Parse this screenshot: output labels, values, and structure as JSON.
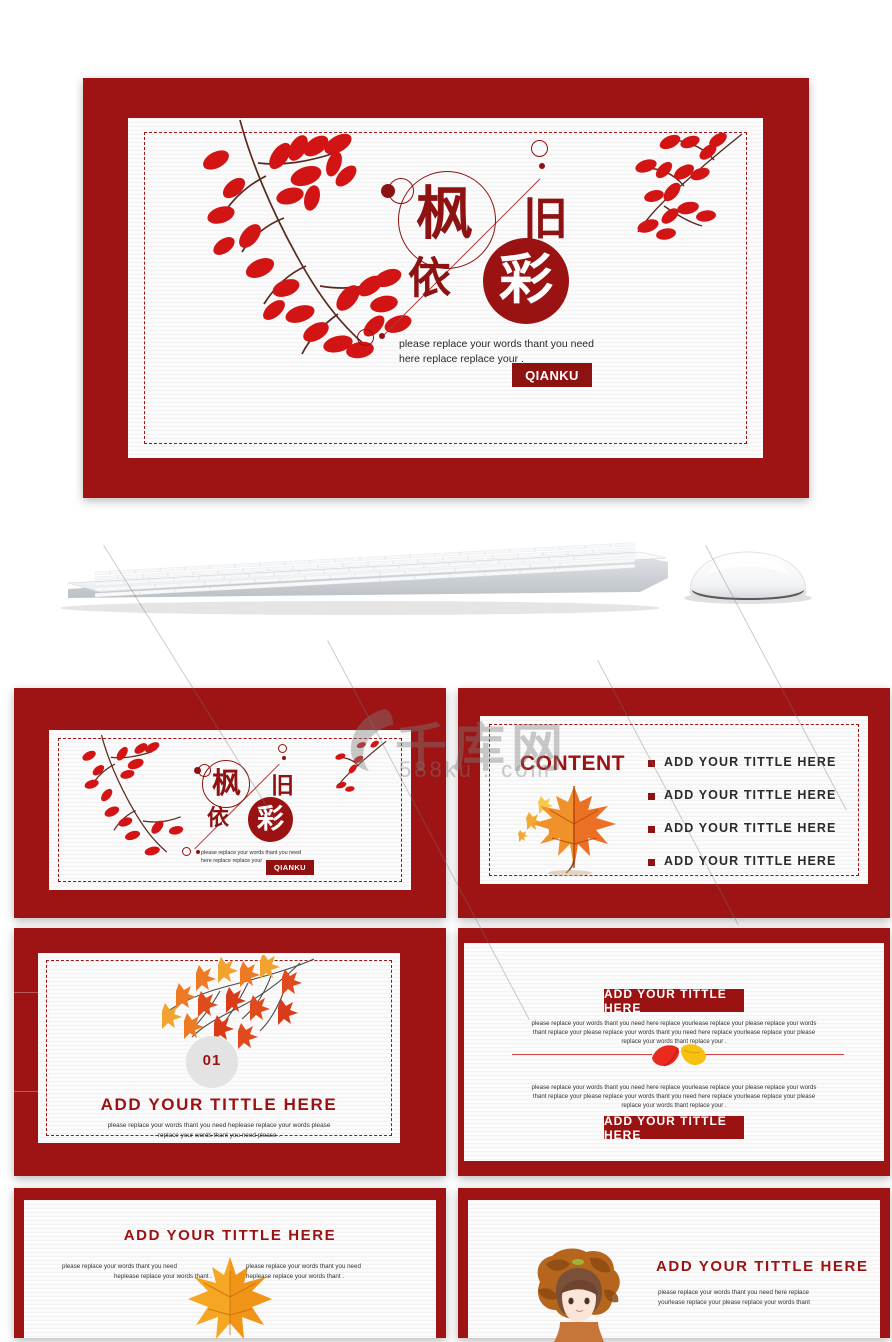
{
  "theme": {
    "deep_red": "#9e1414",
    "brand_red": "#8e1212",
    "paper": "#fbfbfb",
    "text_dark": "#2a2a2a"
  },
  "hero": {
    "hanzi": {
      "feng": "枫",
      "jiu": "旧",
      "yi": "依",
      "cai": "彩"
    },
    "caption_line1": "please replace your  words thant  you need",
    "caption_line2": "here replace replace your  .",
    "button_label": "QIANKU"
  },
  "thumbnails": [
    {
      "id": "slide-title",
      "kind": "title",
      "hanzi": {
        "feng": "枫",
        "jiu": "旧",
        "yi": "依",
        "cai": "彩"
      },
      "caption_line1": "please replace your  words thant  you need",
      "caption_line2": "here replace replace your",
      "button_label": "QIANKU"
    },
    {
      "id": "slide-content",
      "kind": "content",
      "heading": "CONTENT",
      "items": [
        "ADD  YOUR  TITTLE  HERE",
        "ADD  YOUR  TITTLE  HERE",
        "ADD  YOUR  TITTLE  HERE",
        "ADD  YOUR  TITTLE  HERE"
      ]
    },
    {
      "id": "slide-section-01",
      "kind": "section",
      "number": "01",
      "title": "ADD  YOUR  TITTLE  HERE",
      "body_line1": "please replace your  words thant  you need heplease replace your  words please",
      "body_line2": "replace your  words thant  you need please  ."
    },
    {
      "id": "slide-two-blocks",
      "kind": "two-blocks",
      "pill_top": "ADD YOUR TITTLE HERE",
      "pill_bottom": "ADD YOUR TITTLE HERE",
      "paragraph_top_line1": "please replace your  words thant  you need here replace yourlease replace your please replace your  words",
      "paragraph_top_line2": "thant  replace your  please replace your  words thant  you need here replace yourlease replace your please",
      "paragraph_top_line3": "replace your  words thant  replace your .",
      "paragraph_bottom_line1": "please replace your  words thant  you need here replace yourlease replace your please replace your  words",
      "paragraph_bottom_line2": "thant  replace your  please replace your  words thant  you need here replace yourlease replace your please",
      "paragraph_bottom_line3": "replace your  words thant  replace your ."
    },
    {
      "id": "slide-two-columns",
      "kind": "two-columns",
      "title": "ADD  YOUR  TITTLE  HERE",
      "left_line1": "please replace your  words thant  you need",
      "left_line2": "heplease replace your  words thant .",
      "right_line1": "please replace your  words thant  you need",
      "right_line2": "heplease replace your  words thant ."
    },
    {
      "id": "slide-image-right",
      "kind": "image-right",
      "title": "ADD  YOUR  TITTLE  HERE",
      "body_line1": "please replace your  words thant  you need here replace",
      "body_line2": "yourlease replace your please replace your  words thant"
    }
  ],
  "devices": {
    "keyboard_label": "keyboard",
    "mouse_label": "mouse"
  },
  "watermark": {
    "chinese": "千库网",
    "domain": "588ku . com"
  }
}
